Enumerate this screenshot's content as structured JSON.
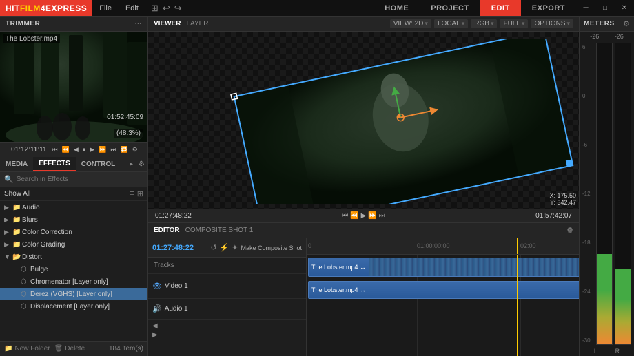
{
  "app": {
    "name": "HITFILM",
    "name_suffix": "4EXPRESS",
    "logo_bg": "#e8392a"
  },
  "top_menu": {
    "items": [
      "File",
      "Edit"
    ],
    "nav_tabs": [
      "HOME",
      "PROJECT",
      "EDIT",
      "EXPORT"
    ],
    "active_tab": "EDIT"
  },
  "trimmer": {
    "title": "TRIMMER",
    "filename": "The Lobster.mp4",
    "zoom": "(48.3%)",
    "time_current": "01:52:45:09",
    "timecode": "01:12:11:11"
  },
  "effects": {
    "tab_media": "MEDIA",
    "tab_effects": "EFFECTS",
    "tab_controls": "CONTROL",
    "search_placeholder": "Search in Effects",
    "show_all": "Show All",
    "tree": [
      {
        "label": "Audio",
        "indent": 1,
        "type": "folder"
      },
      {
        "label": "Blurs",
        "indent": 1,
        "type": "folder"
      },
      {
        "label": "Color Correction",
        "indent": 1,
        "type": "folder"
      },
      {
        "label": "Color Grading",
        "indent": 1,
        "type": "folder"
      },
      {
        "label": "Distort",
        "indent": 1,
        "type": "folder-open"
      },
      {
        "label": "Bulge",
        "indent": 2,
        "type": "item"
      },
      {
        "label": "Chromenator [Layer only]",
        "indent": 2,
        "type": "item"
      },
      {
        "label": "Derez (VGHS) [Layer only]",
        "indent": 2,
        "type": "item",
        "selected": true
      },
      {
        "label": "Displacement [Layer only]",
        "indent": 2,
        "type": "item"
      }
    ]
  },
  "bottom_bar": {
    "new_folder": "New Folder",
    "delete": "Delete",
    "item_count": "184 item(s)"
  },
  "viewer": {
    "tab_viewer": "VIEWER",
    "tab_layer": "LAYER",
    "view_2d": "VIEW: 2D",
    "local": "LOCAL",
    "rgb": "RGB",
    "full": "FULL",
    "options": "OPTIONS",
    "timecode": "01:27:48:22",
    "coords_x": "X: 175.50",
    "coords_y": "Y: 342.47",
    "right_timecode": "01:57:42:07"
  },
  "editor": {
    "tab_editor": "EDITOR",
    "tab_composite": "COMPOSITE SHOT 1",
    "timecode": "01:27:48:22",
    "make_composite": "Make Composite Shot",
    "tracks_label": "Tracks",
    "time_marks": [
      "0",
      "01:00:00:00",
      "02:00"
    ],
    "video_track": "Video 1",
    "audio_track": "Audio 1",
    "clip_name_video": "The Lobster.mp4 ↔",
    "clip_name_audio": "The Lobster.mp4 ↔"
  },
  "meters": {
    "title": "METERS",
    "labels": [
      "-26",
      "-26"
    ],
    "scale": [
      "6",
      "0",
      "-6",
      "-12",
      "-18",
      "-24",
      "-30"
    ],
    "lr_labels": [
      "L",
      "R"
    ]
  }
}
